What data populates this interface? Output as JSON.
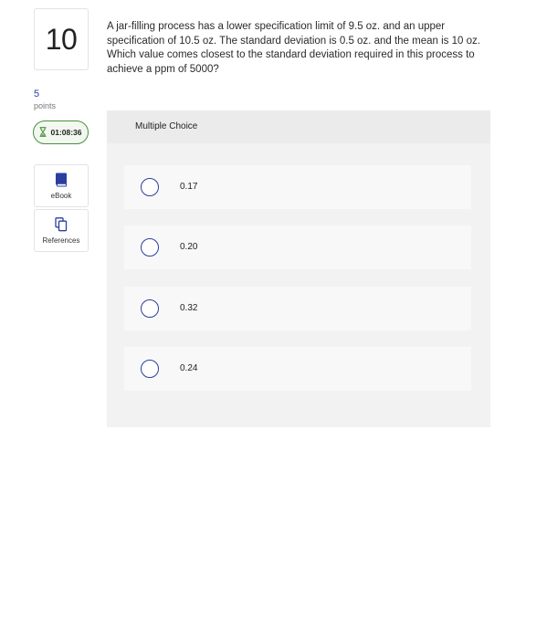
{
  "question": {
    "number": "10",
    "text": "A jar-filling process has a lower specification limit of 9.5 oz. and an upper specification of 10.5 oz. The standard deviation is 0.5 oz. and the mean is 10 oz. Which value comes closest to the standard deviation required in this process to achieve a ppm of 5000?"
  },
  "points": {
    "value": "5",
    "label": "points"
  },
  "timer": {
    "value": "01:08:36",
    "icon": "hourglass-icon",
    "accent_color": "#4b8f3f"
  },
  "tools": [
    {
      "label": "eBook",
      "icon": "book-icon",
      "color": "#2b3f9e"
    },
    {
      "label": "References",
      "icon": "documents-icon",
      "color": "#2b3f9e"
    }
  ],
  "multiple_choice": {
    "title": "Multiple Choice",
    "options": [
      {
        "label": "0.17",
        "selected": false
      },
      {
        "label": "0.20",
        "selected": false
      },
      {
        "label": "0.32",
        "selected": false
      },
      {
        "label": "0.24",
        "selected": false
      }
    ]
  },
  "colors": {
    "accent": "#2b3f9e",
    "panel": "#f2f2f2"
  }
}
